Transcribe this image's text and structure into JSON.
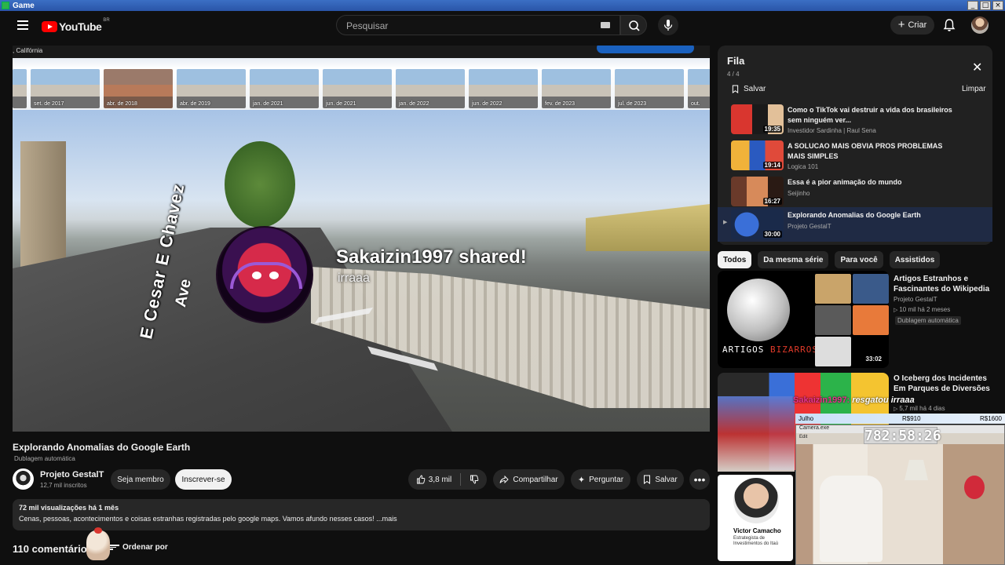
{
  "window": {
    "title": "Game"
  },
  "header": {
    "logo_text": "YouTube",
    "country": "BR",
    "search_placeholder": "Pesquisar",
    "create_label": "Criar"
  },
  "player": {
    "location": ", Califórnia",
    "timeline": [
      "set. de 2017",
      "abr. de 2018",
      "abr. de 2019",
      "jan. de 2021",
      "jun. de 2021",
      "jan. de 2022",
      "jun. de 2022",
      "fev. de 2023",
      "jul. de 2023",
      "out."
    ],
    "street_label_1": "E Cesar E Chavez",
    "street_label_2": "Ave",
    "alert_title": "Sakaizin1997 shared!",
    "alert_sub": "irraaa"
  },
  "video": {
    "title": "Explorando Anomalias do Google Earth",
    "dubbing": "Dublagem automática",
    "channel": "Projeto GestalT",
    "subscribers": "12,7 mil inscritos",
    "join_label": "Seja membro",
    "subscribe_label": "Inscrever-se",
    "likes": "3,8 mil",
    "share_label": "Compartilhar",
    "ask_label": "Perguntar",
    "save_label": "Salvar",
    "views_line": "72 mil visualizações  há 1 mês",
    "description": "Cenas, pessoas, acontecimentos e coisas estranhas registradas pelo google maps. Vamos afundo nesses casos! ...mais",
    "comments": "110 comentários",
    "sort_label": "Ordenar por"
  },
  "queue": {
    "title": "Fila",
    "count": "4 / 4",
    "save_label": "Salvar",
    "clear_label": "Limpar",
    "items": [
      {
        "title": "Como o TikTok vai destruir a vida dos brasileiros sem ninguém ver...",
        "channel": "Investidor Sardinha | Raul Sena",
        "duration": "19:35"
      },
      {
        "title": "A SOLUCAO MAIS OBVIA PROS PROBLEMAS MAIS SIMPLES",
        "channel": "Logica 101",
        "duration": "19:14"
      },
      {
        "title": "Essa é a pior animação do mundo",
        "channel": "Seijinho",
        "duration": "16:27"
      },
      {
        "title": "Explorando Anomalias do Google Earth",
        "channel": "Projeto GestalT",
        "duration": "30:00"
      }
    ]
  },
  "chips": [
    "Todos",
    "Da mesma série",
    "Para você",
    "Assistidos"
  ],
  "recommendations": [
    {
      "title": "Artigos Estranhos e Fascinantes do Wikipedia",
      "channel": "Projeto GestalT",
      "meta": "10 mil  há 2 meses",
      "badge": "Dublagem automática",
      "duration": "33:02",
      "thumb_text_a": "ARTIGOS ",
      "thumb_text_b": "BIZARROS"
    },
    {
      "title": "O Iceberg dos Incidentes Em Parques de Diversões",
      "meta": "5,7 mil  há 4 dias"
    }
  ],
  "overlay": {
    "top_left": "Julho",
    "top_mid": "R$910",
    "top_right": "R$1600",
    "cam_title": "Camera.exe",
    "cam_menu": "Edit",
    "timer": "782:58:26",
    "chat_user": "Sakaizin1997:",
    "chat_msg": " resgatou irraaa",
    "ad_name": "Victor Camacho",
    "ad_role": "Estrategista de Investimentos do Itaú"
  }
}
